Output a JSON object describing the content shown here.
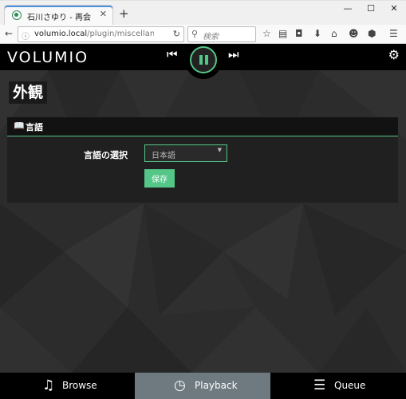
{
  "browser": {
    "tab_title": "石川さゆり - 再会",
    "tab_close": "✕",
    "new_tab": "+",
    "window_controls": [
      "—",
      "☐",
      "✕"
    ],
    "url_host": "volumio.local",
    "url_path": "/plugin/miscellanea-appe",
    "search_placeholder": "検索"
  },
  "app": {
    "logo": "VOLUMIO",
    "accent_color": "#54c688",
    "page_title": "外観",
    "section": {
      "icon": "book-icon",
      "title": "言語",
      "field_label": "言語の選択",
      "select_value": "日本語",
      "save_label": "保存"
    },
    "bottom_nav": [
      {
        "label": "Browse",
        "icon": "music-note-icon",
        "active": false
      },
      {
        "label": "Playback",
        "icon": "clock-icon",
        "active": true
      },
      {
        "label": "Queue",
        "icon": "list-icon",
        "active": false
      }
    ]
  }
}
